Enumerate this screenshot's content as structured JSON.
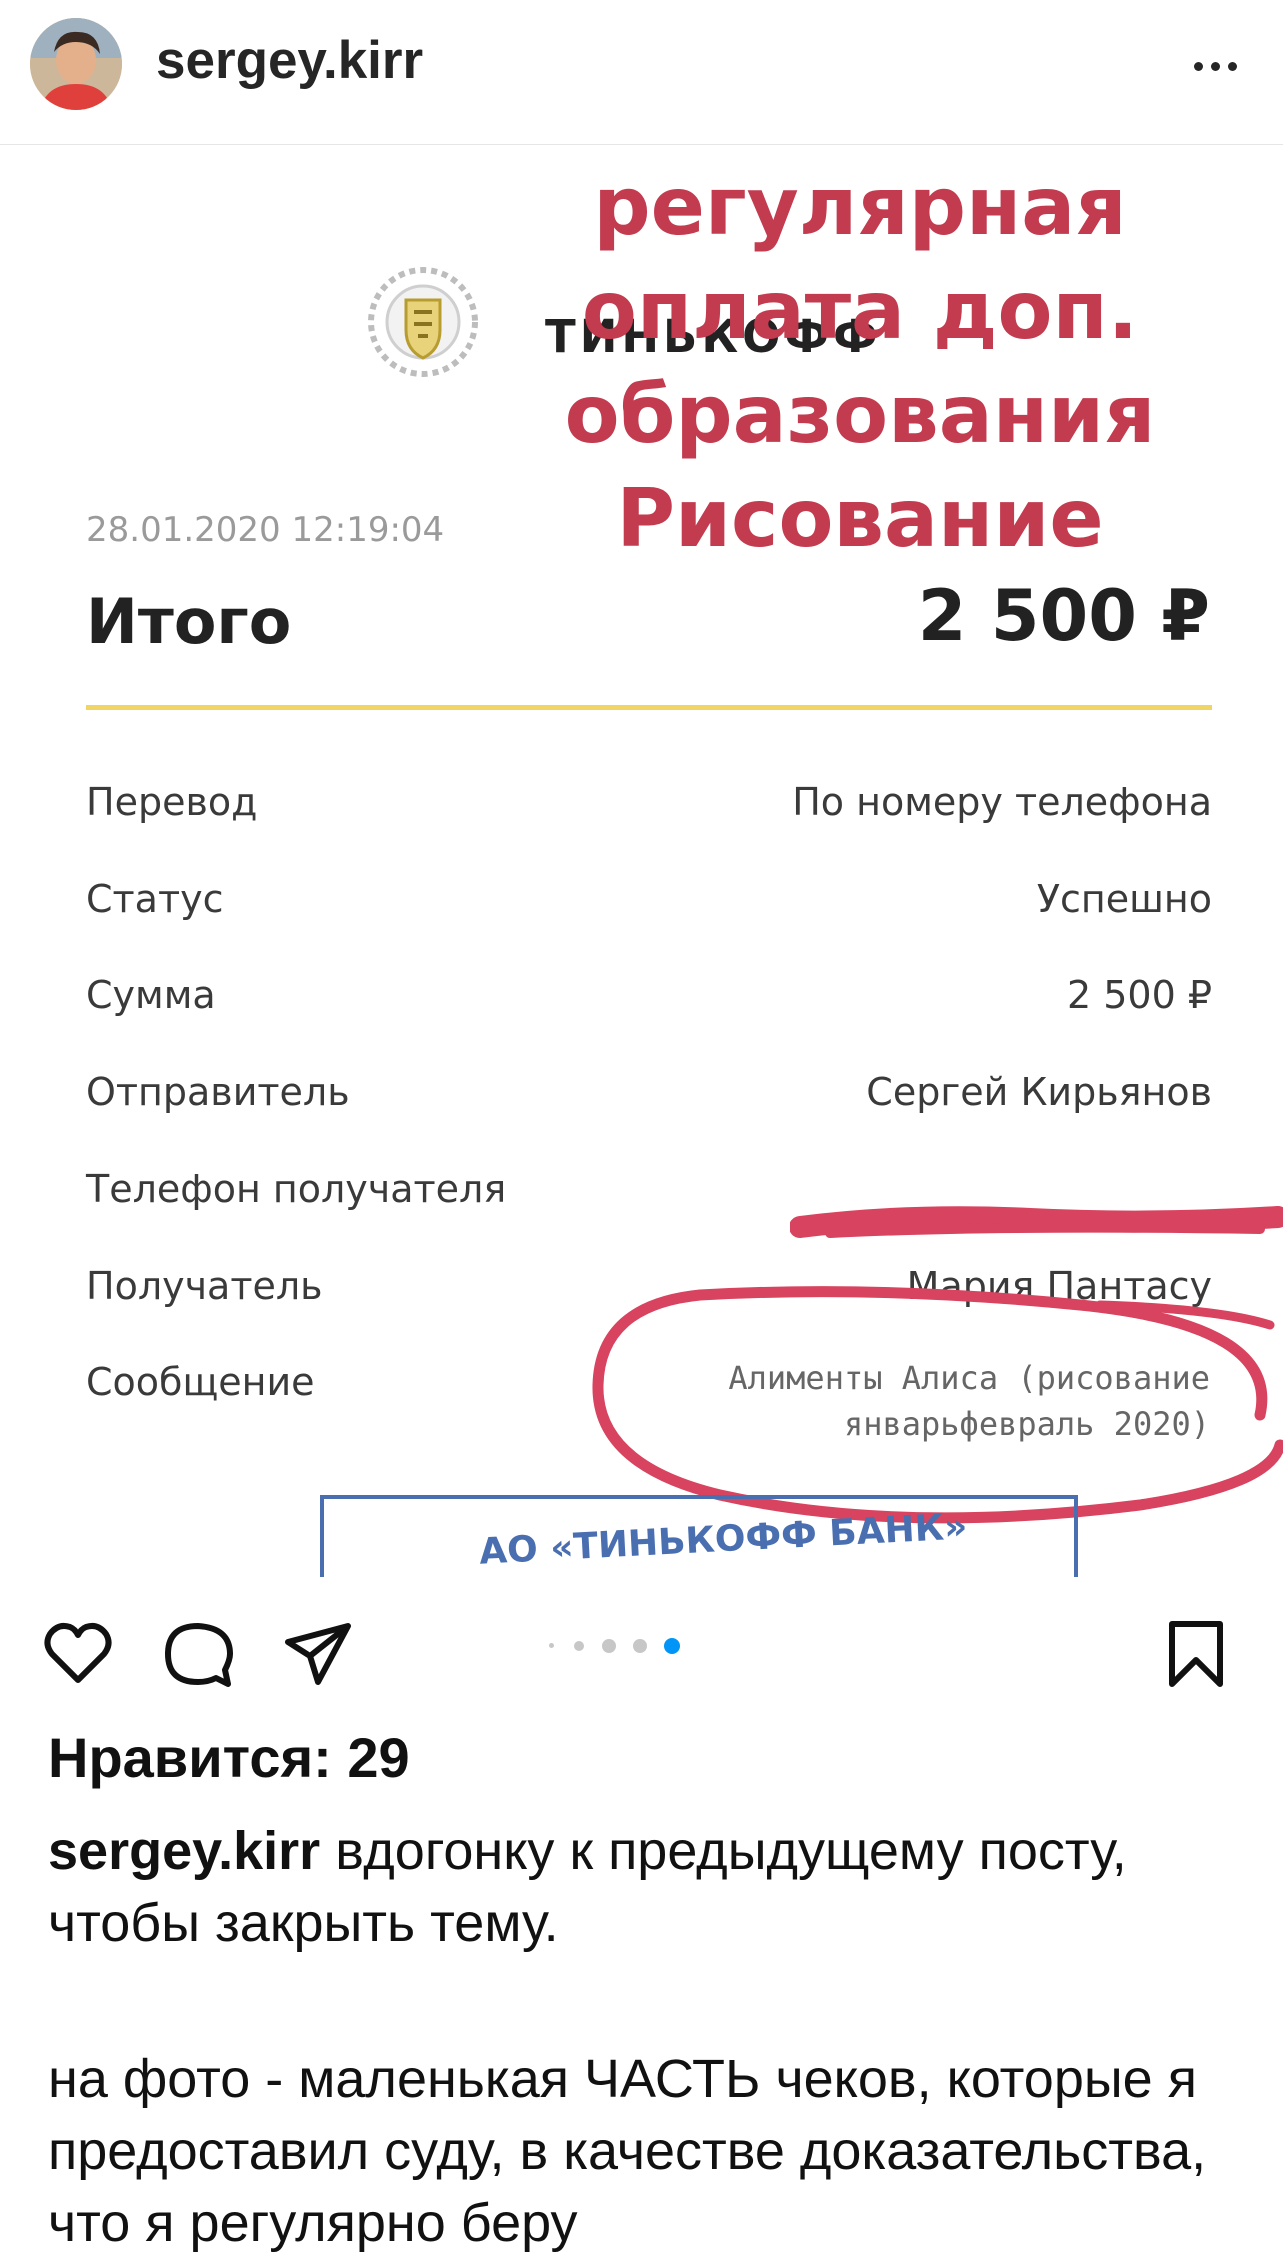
{
  "header": {
    "username": "sergey.kirr",
    "more_icon": "more-horizontal-icon"
  },
  "receipt": {
    "bank_name": "ТИНЬКОФФ",
    "stamp_lines": [
      "регулярная",
      "оплата доп.",
      "образования",
      "Рисование"
    ],
    "date": "28.01.2020 12:19:04",
    "total_label": "Итого",
    "total_value": "2 500 ₽",
    "rows": [
      {
        "label": "Перевод",
        "value": "По номеру телефона"
      },
      {
        "label": "Статус",
        "value": "Успешно"
      },
      {
        "label": "Сумма",
        "value": "2 500 ₽"
      },
      {
        "label": "Отправитель",
        "value": "Сергей Кирьянов"
      },
      {
        "label": "Телефон получателя",
        "value": ""
      },
      {
        "label": "Получатель",
        "value": "Мария Пантасу"
      },
      {
        "label": "Сообщение",
        "value": ""
      }
    ],
    "message_lines": [
      "Алименты Алиса (рисование",
      "январьфевраль 2020)"
    ],
    "bank_stamp": "АО «ТИНЬКОФФ БАНК»",
    "annotation_color": "#d8435f"
  },
  "actions": {
    "like_icon": "heart-icon",
    "comment_icon": "comment-icon",
    "share_icon": "send-icon",
    "save_icon": "bookmark-icon",
    "carousel_active_color": "#0095f6"
  },
  "likes_text": "Нравится: 29",
  "caption": {
    "username": "sergey.kirr",
    "first_text": "вдогонку к предыдущему посту, чтобы закрыть тему.",
    "second_text": "на фото - маленькая ЧАСТЬ чеков, которые я предоставил суду, в качестве доказательства, что я регулярно беру"
  }
}
